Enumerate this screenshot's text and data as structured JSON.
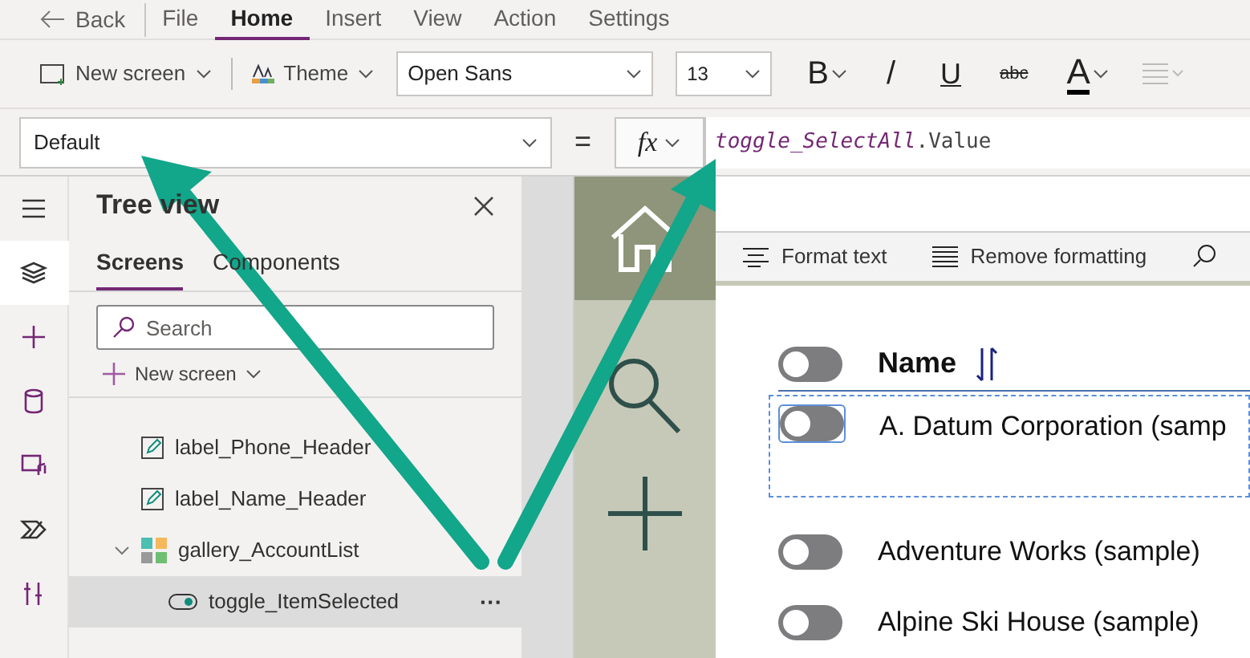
{
  "menu": {
    "back": "Back",
    "tabs": [
      {
        "label": "File",
        "selected": false
      },
      {
        "label": "Home",
        "selected": true
      },
      {
        "label": "Insert",
        "selected": false
      },
      {
        "label": "View",
        "selected": false
      },
      {
        "label": "Action",
        "selected": false
      },
      {
        "label": "Settings",
        "selected": false
      }
    ]
  },
  "toolbar": {
    "new_screen": "New screen",
    "theme": "Theme",
    "font": "Open Sans",
    "size": "13",
    "format_buttons": [
      {
        "kind": "bold",
        "label": "B"
      },
      {
        "kind": "italic",
        "label": "/"
      },
      {
        "kind": "underline",
        "label": "U"
      },
      {
        "kind": "strike",
        "label": "abc"
      },
      {
        "kind": "color",
        "label": "A"
      },
      {
        "kind": "align"
      }
    ]
  },
  "formula_bar": {
    "property": "Default",
    "equals": "=",
    "fx": "fx",
    "identifier": "toggle_SelectAll",
    "rest": ".Value"
  },
  "rail": [
    {
      "kind": "menu",
      "selected": false
    },
    {
      "kind": "layers",
      "selected": true
    },
    {
      "kind": "plus",
      "selected": false
    },
    {
      "kind": "data",
      "selected": false
    },
    {
      "kind": "media",
      "selected": false
    },
    {
      "kind": "flow",
      "selected": false
    },
    {
      "kind": "tools",
      "selected": false
    }
  ],
  "tree_view": {
    "title": "Tree view",
    "tabs": [
      {
        "label": "Screens",
        "selected": true
      },
      {
        "label": "Components",
        "selected": false
      }
    ],
    "search": {
      "placeholder": "Search"
    },
    "new_screen": "New screen",
    "items": [
      {
        "kind": "label",
        "name": "label_Phone_Header",
        "selected": false
      },
      {
        "kind": "label",
        "name": "label_Name_Header",
        "selected": false
      },
      {
        "kind": "gallery",
        "name": "gallery_AccountList",
        "selected": false,
        "expanded": true,
        "children": [
          {
            "kind": "toggle",
            "name": "toggle_ItemSelected",
            "selected": true,
            "more": "···"
          }
        ]
      }
    ]
  },
  "canvas": {
    "format_toolbar": [
      "Format text",
      "Remove formatting"
    ],
    "header": {
      "title": "Name",
      "toggle_on": false
    },
    "rows": [
      {
        "name": "A. Datum Corporation (samp",
        "on": false,
        "selected": true
      },
      {
        "name": "Adventure Works (sample)",
        "on": false,
        "selected": false
      },
      {
        "name": "Alpine Ski House (sample)",
        "on": false,
        "selected": false
      }
    ]
  }
}
